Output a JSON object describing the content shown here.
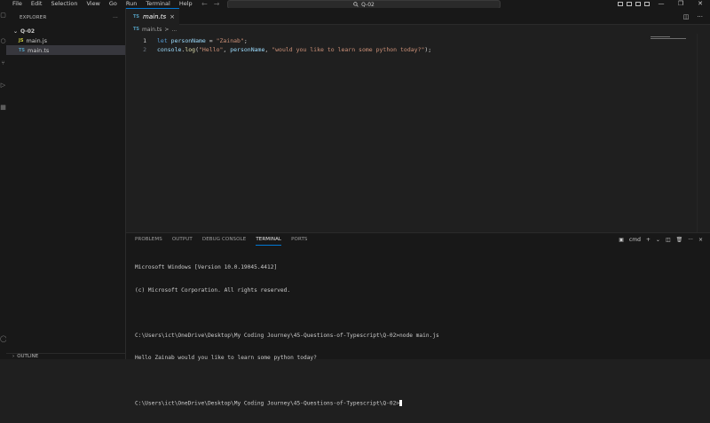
{
  "menu": [
    "File",
    "Edit",
    "Selection",
    "View",
    "Go",
    "Run",
    "Terminal",
    "Help"
  ],
  "command_center": {
    "text": "Q-02",
    "icon": "search-icon"
  },
  "window_controls": {
    "minimize": "—",
    "restore": "❐",
    "close": "✕"
  },
  "sidebar": {
    "title": "EXPLORER",
    "more": "···",
    "folder": "Q-02",
    "files": [
      {
        "badge": "JS",
        "name": "main.js",
        "active": false
      },
      {
        "badge": "TS",
        "name": "main.ts",
        "active": true
      }
    ],
    "outline": "OUTLINE"
  },
  "tab": {
    "badge": "TS",
    "label": "main.ts",
    "close": "×"
  },
  "breadcrumb": {
    "badge": "TS",
    "file": "main.ts",
    "sep": ">",
    "rest": "..."
  },
  "code_lines": [
    {
      "number": "1",
      "tokens": [
        {
          "t": "let",
          "c": "kw"
        },
        {
          "t": " ",
          "c": "plain"
        },
        {
          "t": "personName",
          "c": "var"
        },
        {
          "t": " = ",
          "c": "plain"
        },
        {
          "t": "\"Zainab\"",
          "c": "str"
        },
        {
          "t": ";",
          "c": "plain"
        }
      ]
    },
    {
      "number": "2",
      "tokens": [
        {
          "t": "console",
          "c": "var"
        },
        {
          "t": ".",
          "c": "plain"
        },
        {
          "t": "log",
          "c": "fn"
        },
        {
          "t": "(",
          "c": "plain"
        },
        {
          "t": "\"Hello\"",
          "c": "str"
        },
        {
          "t": ", ",
          "c": "plain"
        },
        {
          "t": "personName",
          "c": "var"
        },
        {
          "t": ", ",
          "c": "plain"
        },
        {
          "t": "\"would you like to learn some python today?\"",
          "c": "str"
        },
        {
          "t": ");",
          "c": "plain"
        }
      ]
    }
  ],
  "panel": {
    "tabs": [
      "PROBLEMS",
      "OUTPUT",
      "DEBUG CONSOLE",
      "TERMINAL",
      "PORTS"
    ],
    "active_tab": "TERMINAL",
    "shell": "cmd",
    "add": "+",
    "dropdown": "⌄",
    "more": "···",
    "close": "×"
  },
  "terminal_lines": [
    "Microsoft Windows [Version 10.0.19045.4412]",
    "(c) Microsoft Corporation. All rights reserved.",
    "",
    "C:\\Users\\ict\\OneDrive\\Desktop\\My Coding Journey\\45-Questions-of-Typescript\\Q-02>node main.js",
    "Hello Zainab would you like to learn some python today?",
    "",
    "C:\\Users\\ict\\OneDrive\\Desktop\\My Coding Journey\\45-Questions-of-Typescript\\Q-02>"
  ]
}
